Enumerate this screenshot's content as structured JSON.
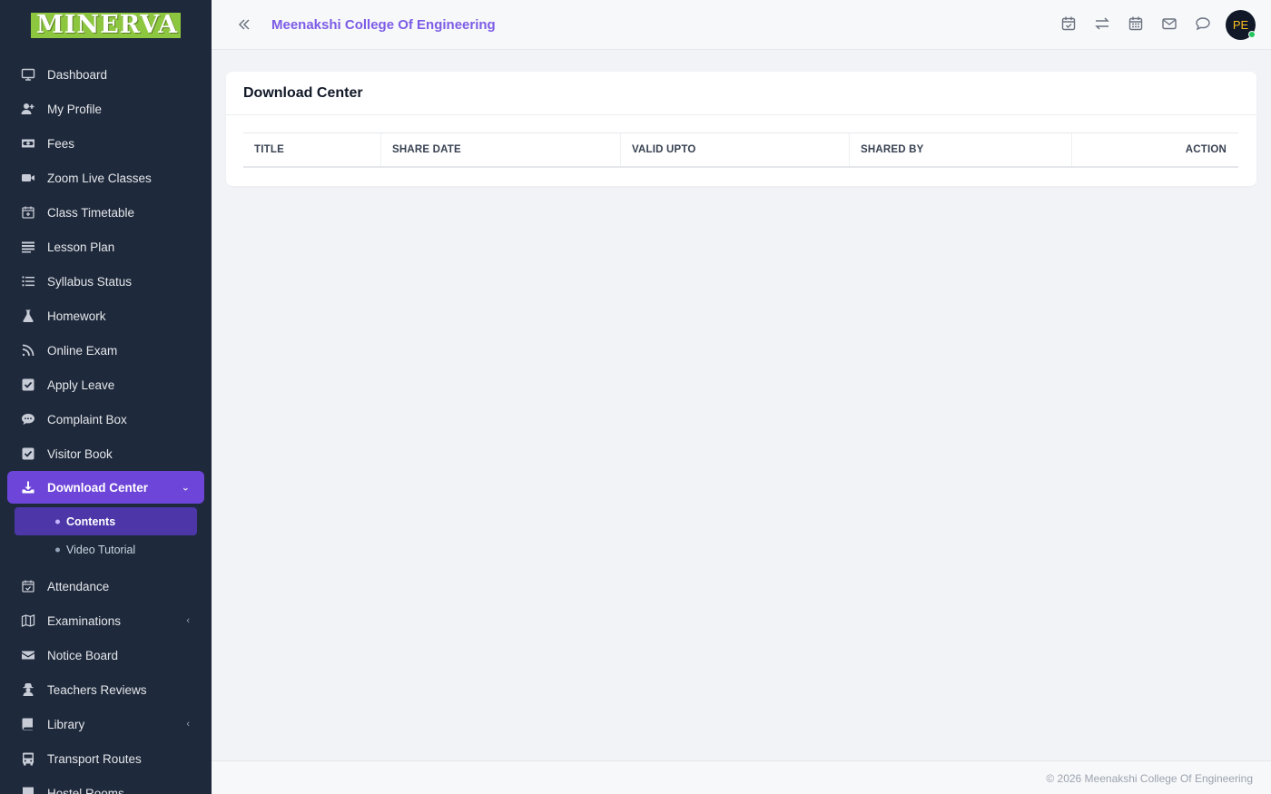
{
  "brand": {
    "logo_text": "MINERVA"
  },
  "header": {
    "college_name": "Meenakshi College Of Engineering",
    "avatar_initials": "PE"
  },
  "sidebar": {
    "items": [
      {
        "label": "Dashboard",
        "icon": "monitor-icon"
      },
      {
        "label": "My Profile",
        "icon": "user-plus-icon"
      },
      {
        "label": "Fees",
        "icon": "money-icon"
      },
      {
        "label": "Zoom Live Classes",
        "icon": "video-icon"
      },
      {
        "label": "Class Timetable",
        "icon": "calendar-plus-icon"
      },
      {
        "label": "Lesson Plan",
        "icon": "list-icon"
      },
      {
        "label": "Syllabus Status",
        "icon": "list-ordered-icon"
      },
      {
        "label": "Homework",
        "icon": "flask-icon"
      },
      {
        "label": "Online Exam",
        "icon": "rss-icon"
      },
      {
        "label": "Apply Leave",
        "icon": "check-square-icon"
      },
      {
        "label": "Complaint Box",
        "icon": "chat-icon"
      },
      {
        "label": "Visitor Book",
        "icon": "check-square-icon"
      },
      {
        "label": "Download Center",
        "icon": "download-icon",
        "active": true
      },
      {
        "label": "Attendance",
        "icon": "calendar-check-icon"
      },
      {
        "label": "Examinations",
        "icon": "map-icon"
      },
      {
        "label": "Notice Board",
        "icon": "envelope-icon"
      },
      {
        "label": "Teachers Reviews",
        "icon": "user-secret-icon"
      },
      {
        "label": "Library",
        "icon": "book-icon"
      },
      {
        "label": "Transport Routes",
        "icon": "bus-icon"
      },
      {
        "label": "Hostel Rooms",
        "icon": "building-icon"
      }
    ],
    "download_sub": [
      {
        "label": "Contents",
        "active": true
      },
      {
        "label": "Video Tutorial"
      }
    ]
  },
  "card": {
    "title": "Download Center",
    "columns": [
      "TITLE",
      "SHARE DATE",
      "VALID UPTO",
      "SHARED BY",
      "ACTION"
    ]
  },
  "footer": {
    "copyright": "© 2026 Meenakshi College Of Engineering"
  }
}
